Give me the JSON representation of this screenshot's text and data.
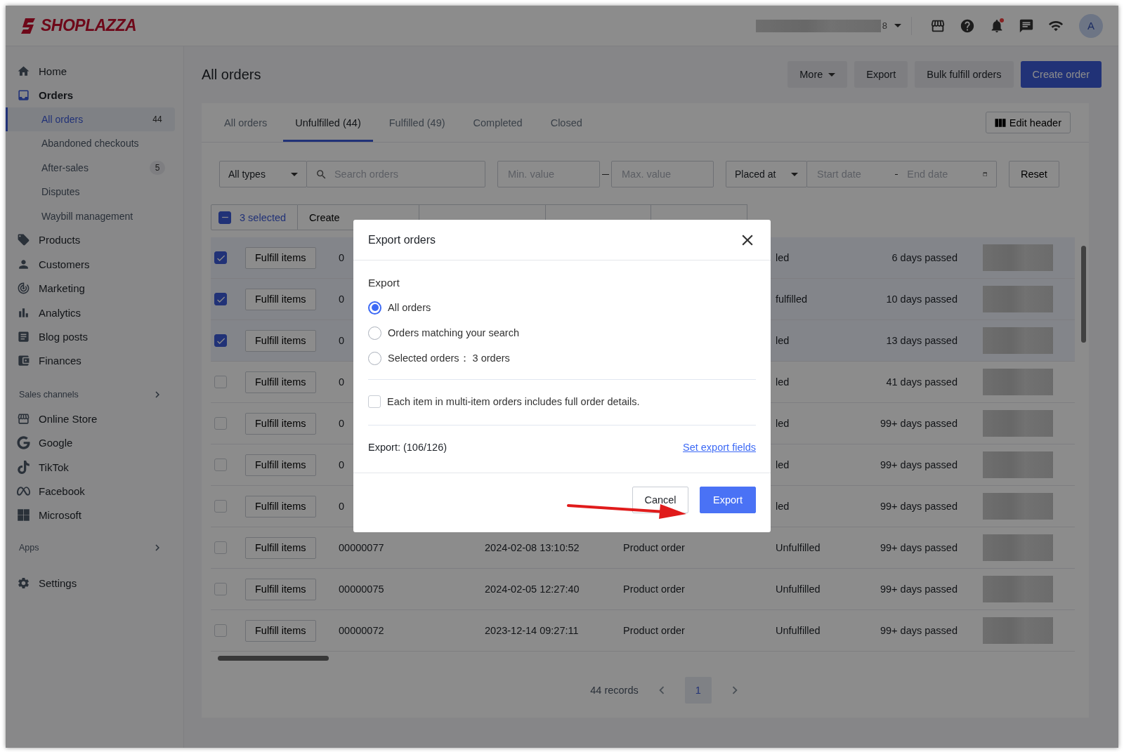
{
  "header": {
    "logo": "SHOPLAZZA",
    "store_suffix": "8",
    "avatar": "A",
    "notification_dot": true
  },
  "sidebar": {
    "items": [
      {
        "label": "Home",
        "selected": false
      },
      {
        "label": "Orders",
        "selected": true,
        "children": [
          {
            "label": "All orders",
            "count": "44",
            "selected": true
          },
          {
            "label": "Abandoned checkouts",
            "selected": false
          },
          {
            "label": "After-sales",
            "count": "5",
            "selected": false
          },
          {
            "label": "Disputes",
            "selected": false
          },
          {
            "label": "Waybill management",
            "selected": false
          }
        ]
      },
      {
        "label": "Products",
        "selected": false
      },
      {
        "label": "Customers",
        "selected": false
      },
      {
        "label": "Marketing",
        "selected": false
      },
      {
        "label": "Analytics",
        "selected": false
      },
      {
        "label": "Blog posts",
        "selected": false
      },
      {
        "label": "Finances",
        "selected": false
      }
    ],
    "sections": [
      {
        "title": "Sales channels",
        "items": [
          {
            "label": "Online Store"
          },
          {
            "label": "Google"
          },
          {
            "label": "TikTok"
          },
          {
            "label": "Facebook"
          },
          {
            "label": "Microsoft"
          }
        ]
      },
      {
        "title": "Apps"
      }
    ],
    "footer": {
      "label": "Settings"
    }
  },
  "page": {
    "title": "All orders",
    "actions": [
      {
        "label": "More",
        "kind": "dropdown"
      },
      {
        "label": "Export",
        "kind": "default"
      },
      {
        "label": "Bulk fulfill orders",
        "kind": "default"
      },
      {
        "label": "Create order",
        "kind": "primary"
      }
    ],
    "tabs": [
      {
        "label": "All orders",
        "selected": false
      },
      {
        "label": "Unfulfilled (44)",
        "selected": true
      },
      {
        "label": "Fulfilled (49)",
        "selected": false
      },
      {
        "label": "Completed",
        "selected": false
      },
      {
        "label": "Closed",
        "selected": false
      }
    ],
    "edit_header": "Edit header",
    "filters": {
      "type": "All types",
      "search_placeholder": "Search orders",
      "min_placeholder": "Min. value",
      "max_placeholder": "Max. value",
      "date_field": "Placed at",
      "start_placeholder": "Start date",
      "end_placeholder": "End date",
      "reset": "Reset"
    },
    "bulk_bar": {
      "indeterminate": true,
      "selected": "3 selected",
      "actions": [
        "Create"
      ]
    },
    "rows": [
      {
        "checked": true,
        "button": "Fulfill items",
        "order": "0",
        "status": "led",
        "age": "6 days passed"
      },
      {
        "checked": true,
        "button": "Fulfill items",
        "order": "0",
        "status": "fulfilled",
        "age": "10 days passed"
      },
      {
        "checked": true,
        "button": "Fulfill items",
        "order": "0",
        "status": "led",
        "age": "13 days passed"
      },
      {
        "checked": false,
        "button": "Fulfill items",
        "order": "0",
        "status": "led",
        "age": "41 days passed"
      },
      {
        "checked": false,
        "button": "Fulfill items",
        "order": "0",
        "status": "led",
        "age": "99+ days passed"
      },
      {
        "checked": false,
        "button": "Fulfill items",
        "order": "0",
        "status": "led",
        "age": "99+ days passed"
      },
      {
        "checked": false,
        "button": "Fulfill items",
        "order": "0",
        "status": "led",
        "age": "99+ days passed"
      },
      {
        "checked": false,
        "button": "Fulfill items",
        "order": "00000077",
        "date": "2024-02-08 13:10:52",
        "type": "Product order",
        "status": "Unfulfilled",
        "age": "99+ days passed"
      },
      {
        "checked": false,
        "button": "Fulfill items",
        "order": "00000075",
        "date": "2024-02-05 12:27:40",
        "type": "Product order",
        "status": "Unfulfilled",
        "age": "99+ days passed"
      },
      {
        "checked": false,
        "button": "Fulfill items",
        "order": "00000072",
        "date": "2023-12-14 09:27:11",
        "type": "Product order",
        "status": "Unfulfilled",
        "age": "99+ days passed"
      }
    ],
    "pagination": {
      "records": "44 records",
      "pages": [
        {
          "label": "1",
          "selected": true
        }
      ]
    }
  },
  "dialog": {
    "title": "Export orders",
    "section": "Export",
    "options": [
      {
        "label": "All orders",
        "selected": true
      },
      {
        "label": "Orders matching your search",
        "selected": false
      },
      {
        "label": "Selected orders： 3 orders",
        "selected": false
      }
    ],
    "checkbox": {
      "label": "Each item in multi-item orders includes full order details.",
      "checked": false
    },
    "count": "Export: (106/126)",
    "link": "Set export fields",
    "buttons": [
      {
        "label": "Cancel",
        "kind": "default"
      },
      {
        "label": "Export",
        "kind": "primary"
      }
    ]
  }
}
